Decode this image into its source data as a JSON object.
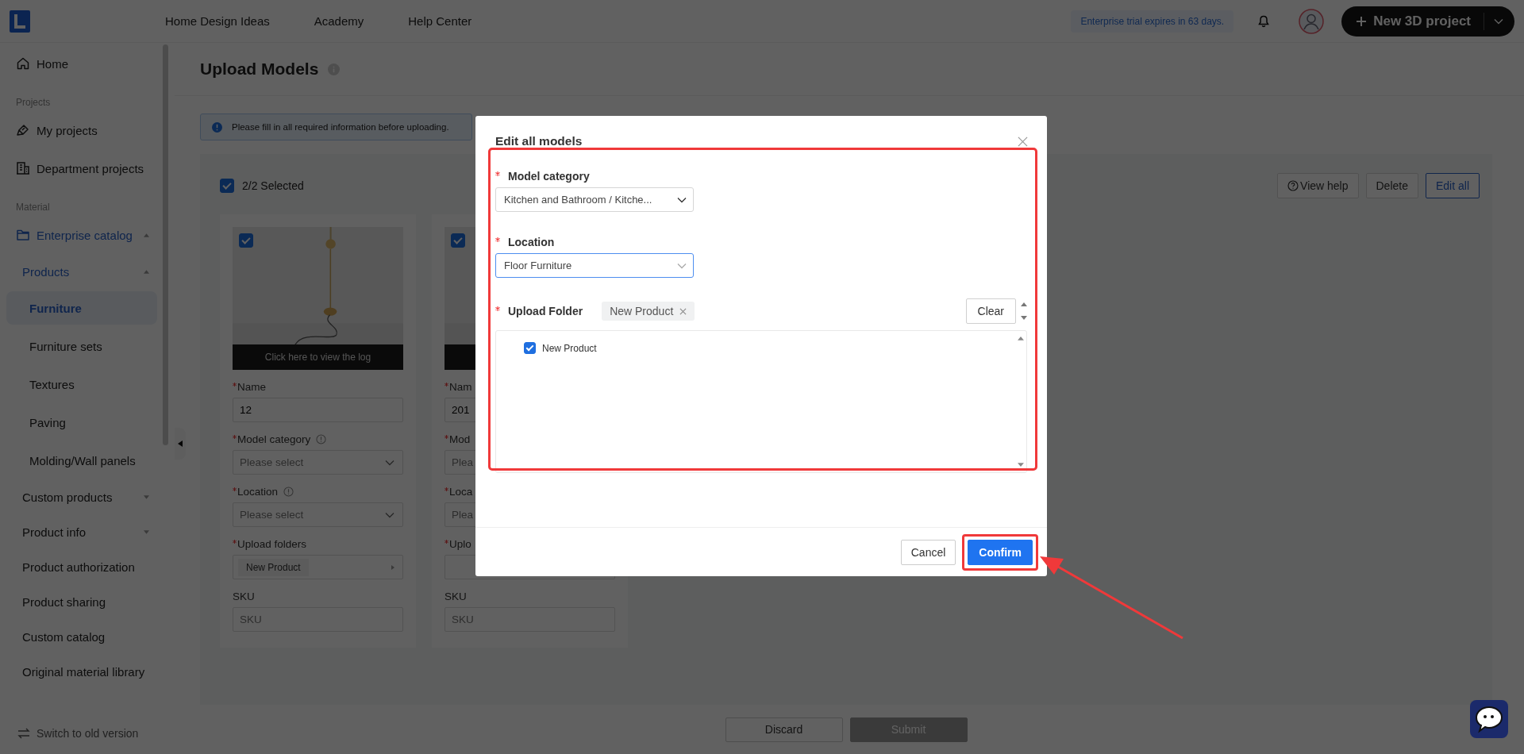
{
  "top_bar": {
    "nav": [
      {
        "label": "Home Design Ideas"
      },
      {
        "label": "Academy"
      },
      {
        "label": "Help Center"
      }
    ],
    "trial_notice": "Enterprise trial expires in 63 days.",
    "new_project_button": "New 3D project"
  },
  "sidebar": {
    "items": [
      {
        "label": "Home",
        "kind": "item",
        "selected": false
      },
      {
        "label": "Projects",
        "kind": "section"
      },
      {
        "label": "My projects",
        "kind": "item",
        "selected": false
      },
      {
        "label": "Department projects",
        "kind": "item",
        "selected": false
      },
      {
        "label": "Material",
        "kind": "section"
      },
      {
        "label": "Enterprise catalog",
        "kind": "item",
        "selected": false,
        "expanded": true,
        "children": [
          {
            "label": "Products",
            "kind": "item",
            "selected": false,
            "expanded": true,
            "children": [
              {
                "label": "Furniture",
                "kind": "item",
                "selected": true
              },
              {
                "label": "Furniture sets",
                "kind": "item",
                "selected": false
              },
              {
                "label": "Textures",
                "kind": "item",
                "selected": false
              },
              {
                "label": "Paving",
                "kind": "item",
                "selected": false
              },
              {
                "label": "Molding/Wall panels",
                "kind": "item",
                "selected": false
              }
            ]
          },
          {
            "label": "Custom products",
            "kind": "item",
            "selected": false,
            "expanded": false
          },
          {
            "label": "Product info",
            "kind": "item",
            "selected": false,
            "expanded": false
          },
          {
            "label": "Product authorization",
            "kind": "item",
            "selected": false
          },
          {
            "label": "Product sharing",
            "kind": "item",
            "selected": false
          },
          {
            "label": "Custom catalog",
            "kind": "item",
            "selected": false
          },
          {
            "label": "Original material library",
            "kind": "item",
            "selected": false
          }
        ]
      }
    ],
    "footer": "Switch to old version"
  },
  "page": {
    "title": "Upload Models",
    "alert": "Please fill in all required information before uploading.",
    "selection": {
      "label": "2/2 Selected",
      "checked": true
    },
    "toolbar": [
      {
        "label": "View help",
        "kind": "help"
      },
      {
        "label": "Delete",
        "kind": "default"
      },
      {
        "label": "Edit all",
        "kind": "outline"
      }
    ],
    "cards": [
      {
        "checked": true,
        "log_label": "Click here to view the log",
        "fields": [
          {
            "label": "Name",
            "required": true,
            "kind": "input",
            "value": "12"
          },
          {
            "label": "Model category",
            "required": true,
            "info": true,
            "kind": "select",
            "placeholder": "Please select",
            "caret": true
          },
          {
            "label": "Location",
            "required": true,
            "info": true,
            "kind": "select",
            "placeholder": "Please select",
            "caret": true
          },
          {
            "label": "Upload folders",
            "required": true,
            "kind": "folder",
            "tag": "New Product"
          },
          {
            "label": "SKU",
            "required": false,
            "kind": "input",
            "placeholder": "SKU"
          }
        ]
      },
      {
        "checked": true,
        "fields": [
          {
            "label": "Nam",
            "required": true,
            "kind": "input",
            "value": "201"
          },
          {
            "label": "Mod",
            "required": true,
            "kind": "select",
            "placeholder": "Plea"
          },
          {
            "label": "Loca",
            "required": true,
            "kind": "select",
            "placeholder": "Plea"
          },
          {
            "label": "Uplo",
            "required": true,
            "kind": "folder"
          },
          {
            "label": "SKU",
            "required": false,
            "kind": "input",
            "placeholder": "SKU"
          }
        ]
      }
    ],
    "bottom_buttons": [
      {
        "label": "Discard",
        "disabled": false
      },
      {
        "label": "Submit",
        "disabled": true
      }
    ]
  },
  "modal": {
    "title": "Edit all models",
    "fields": [
      {
        "label": "Model category",
        "required": true,
        "kind": "select",
        "value": "Kitchen and Bathroom / Kitche...",
        "focused": false
      },
      {
        "label": "Location",
        "required": true,
        "kind": "select",
        "value": "Floor Furniture",
        "focused": true
      },
      {
        "label": "Upload Folder",
        "required": true,
        "kind": "folder",
        "tags": [
          "New Product"
        ],
        "clear_button": "Clear",
        "tree": [
          {
            "label": "New Product",
            "checked": true
          }
        ]
      }
    ],
    "buttons": [
      {
        "label": "Cancel",
        "kind": "default"
      },
      {
        "label": "Confirm",
        "kind": "primary",
        "highlighted": true
      }
    ]
  }
}
